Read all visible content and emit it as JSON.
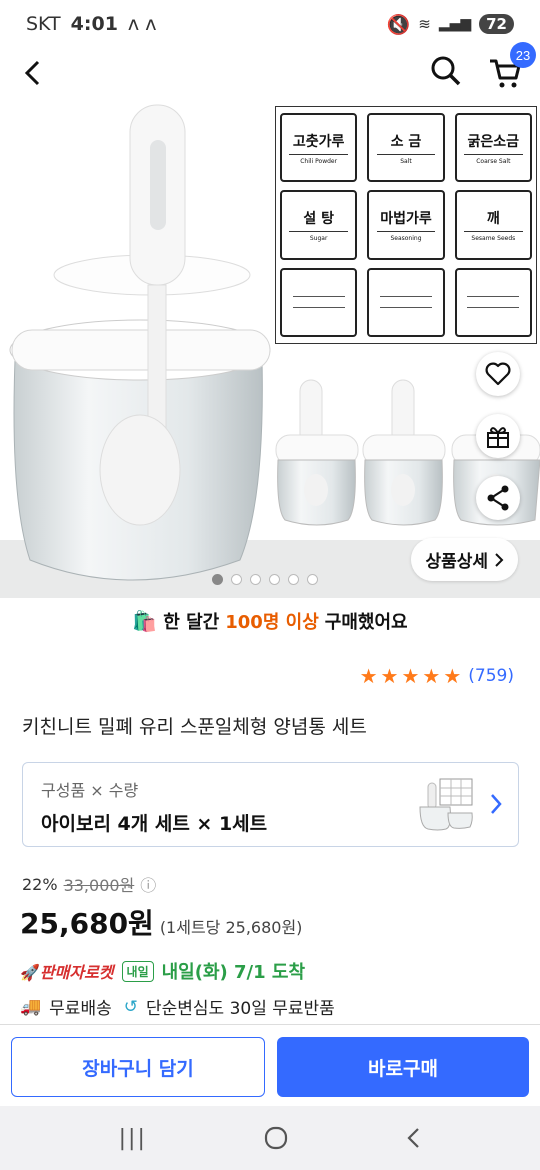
{
  "status": {
    "carrier": "SKT",
    "time": "4:01",
    "battery": "72"
  },
  "header": {
    "cart_count": "23"
  },
  "labels": [
    {
      "ko": "고춧가루",
      "en": "Chili Powder"
    },
    {
      "ko": "소  금",
      "en": "Salt"
    },
    {
      "ko": "굵은소금",
      "en": "Coarse Salt"
    },
    {
      "ko": "설  탕",
      "en": "Sugar"
    },
    {
      "ko": "마법가루",
      "en": "Seasoning"
    },
    {
      "ko": "깨",
      "en": "Sesame Seeds"
    }
  ],
  "hero": {
    "detail_label": "상품상세",
    "image_count": 6,
    "active_index": 0
  },
  "sold": {
    "prefix": "한 달간",
    "highlight": "100명 이상",
    "suffix": "구매했어요"
  },
  "rating": {
    "stars": 5,
    "count": "(759)"
  },
  "product": {
    "title": "키친니트 밀폐 유리 스푼일체형 양념통 세트"
  },
  "option": {
    "key": "구성품 × 수량",
    "value": "아이보리 4개 세트 × 1세트"
  },
  "price": {
    "discount": "22%",
    "original": "33,000원",
    "current": "25,680원",
    "unit_price": "(1세트당 25,680원)"
  },
  "delivery": {
    "rocket": "판매자로켓",
    "badge": "내일",
    "arrival": "내일(화) 7/1 도착"
  },
  "shipping": {
    "free": "무료배송",
    "return": "단순변심도 30일 무료반품"
  },
  "actions": {
    "cart": "장바구니 담기",
    "buy": "바로구매"
  },
  "colors": {
    "accent": "#346aff",
    "rating": "#ff7a1a",
    "rocket": "#d62f2f",
    "arrival": "#2b9e48"
  }
}
